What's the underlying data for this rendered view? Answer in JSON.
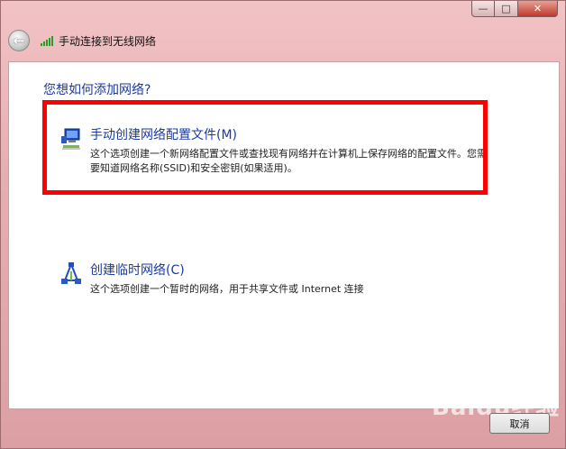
{
  "window": {
    "title": "手动连接到无线网络",
    "caption": {
      "minimize": "—",
      "maximize": "□",
      "close": "✕"
    }
  },
  "content": {
    "heading": "您想如何添加网络?",
    "options": [
      {
        "title": "手动创建网络配置文件(M)",
        "desc": "这个选项创建一个新网络配置文件或查找现有网络并在计算机上保存网络的配置文件。您需要知道网络名称(SSID)和安全密钥(如果适用)。",
        "icon": "network-computer-icon"
      },
      {
        "title": "创建临时网络(C)",
        "desc": "这个选项创建一个暂时的网络，用于共享文件或 Internet 连接",
        "icon": "adhoc-network-icon"
      }
    ]
  },
  "footer": {
    "cancel_label": "取消"
  },
  "watermark": "Baidu经验",
  "colors": {
    "accent": "#1c3a9e",
    "highlight": "#ff0000",
    "signal": "#2e9a2e"
  }
}
